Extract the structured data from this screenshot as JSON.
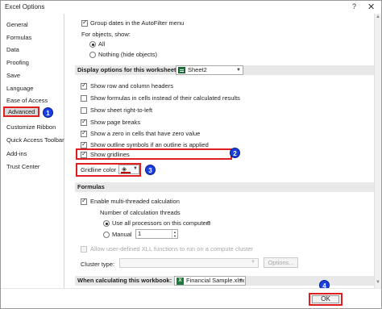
{
  "window": {
    "title": "Excel Options",
    "help_glyph": "?",
    "close_glyph": "✕"
  },
  "sidebar": {
    "items": [
      {
        "label": "General"
      },
      {
        "label": "Formulas"
      },
      {
        "label": "Data"
      },
      {
        "label": "Proofing"
      },
      {
        "label": "Save"
      },
      {
        "label": "Language"
      },
      {
        "label": "Ease of Access"
      },
      {
        "label": "Advanced",
        "selected": true
      },
      {
        "label": "Customize Ribbon"
      },
      {
        "label": "Quick Access Toolbar"
      },
      {
        "label": "Add-ins"
      },
      {
        "label": "Trust Center"
      }
    ]
  },
  "badges": {
    "b1": "1",
    "b2": "2",
    "b3": "3",
    "b4": "4",
    "color": "#1a3fe0"
  },
  "main": {
    "group_dates": {
      "label": "Group dates in the AutoFilter menu",
      "checked": true
    },
    "for_objects_label": "For objects, show:",
    "objects_all": {
      "label": "All",
      "selected": true
    },
    "objects_nothing": {
      "label": "Nothing (hide objects)",
      "selected": false
    },
    "worksheet_section": {
      "label": "Display options for this worksheet:",
      "sheet": "Sheet2"
    },
    "ws_options": [
      {
        "label": "Show row and column headers",
        "checked": true
      },
      {
        "label": "Show formulas in cells instead of their calculated results",
        "checked": false
      },
      {
        "label": "Show sheet right-to-left",
        "checked": false
      },
      {
        "label": "Show page breaks",
        "checked": true
      },
      {
        "label": "Show a zero in cells that have zero value",
        "checked": true
      },
      {
        "label": "Show outline symbols if an outline is applied",
        "checked": true
      },
      {
        "label": "Show gridlines",
        "checked": true
      }
    ],
    "gridline_color_label": "Gridline color",
    "gridline_color": "#c00000",
    "formulas_section": "Formulas",
    "multithread": {
      "label": "Enable multi-threaded calculation",
      "checked": true
    },
    "threads_label": "Number of calculation threads",
    "use_all_processors": {
      "label": "Use all processors on this computer:",
      "value": "8",
      "selected": true
    },
    "manual": {
      "label": "Manual",
      "value": "1",
      "selected": false
    },
    "xll": {
      "label": "Allow user-defined XLL functions to run on a compute cluster",
      "checked": false
    },
    "cluster_type_label": "Cluster type:",
    "options_button": "Options...",
    "workbook_section": {
      "label": "When calculating this workbook:",
      "workbook": "Financial Sample.xlsx"
    }
  },
  "footer": {
    "ok_label": "OK"
  },
  "accent_red": "#e02020"
}
